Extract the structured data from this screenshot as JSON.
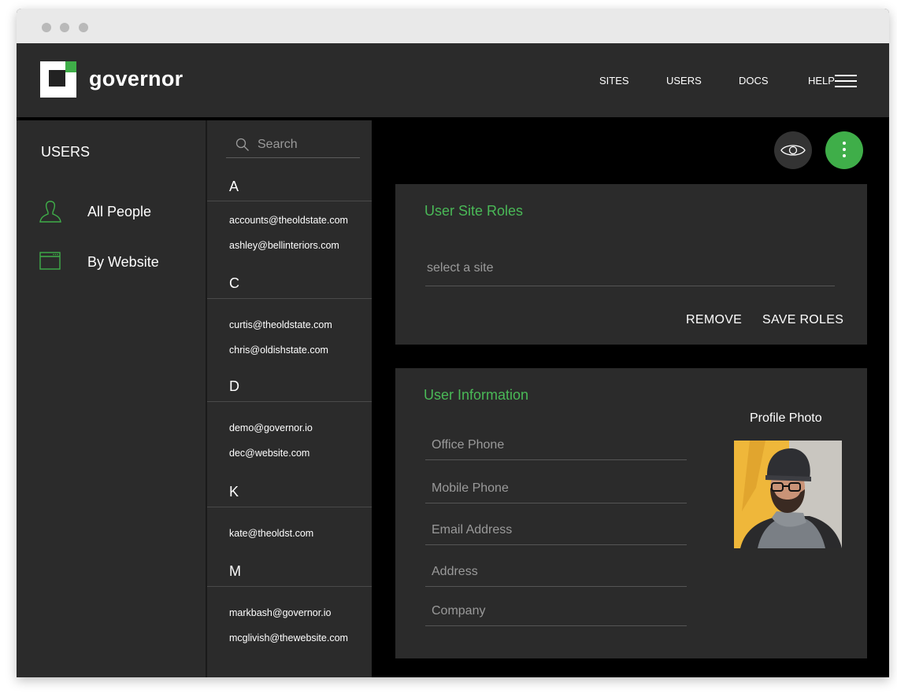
{
  "app": {
    "brand": "governor",
    "nav": [
      "SITES",
      "USERS",
      "DOCS",
      "HELP"
    ]
  },
  "sidebar": {
    "title": "USERS",
    "items": [
      {
        "label": "All People",
        "icon": "person-icon"
      },
      {
        "label": "By Website",
        "icon": "browser-window-icon"
      }
    ]
  },
  "user_list": {
    "search_placeholder": "Search",
    "groups": [
      {
        "letter": "A",
        "emails": [
          "accounts@theoldstate.com",
          "ashley@bellinteriors.com"
        ]
      },
      {
        "letter": "C",
        "emails": [
          "curtis@theoldstate.com",
          "chris@oldishstate.com"
        ]
      },
      {
        "letter": "D",
        "emails": [
          "demo@governor.io",
          "dec@website.com"
        ]
      },
      {
        "letter": "K",
        "emails": [
          "kate@theoldst.com"
        ]
      },
      {
        "letter": "M",
        "emails": [
          "markbash@governor.io",
          "mcglivish@thewebsite.com"
        ]
      }
    ]
  },
  "site_roles": {
    "title": "User Site Roles",
    "select_placeholder": "select a site",
    "remove_label": "REMOVE",
    "save_label": "SAVE ROLES"
  },
  "user_info": {
    "title": "User Information",
    "photo_label": "Profile Photo",
    "fields": [
      {
        "placeholder": "Office Phone"
      },
      {
        "placeholder": "Mobile Phone"
      },
      {
        "placeholder": "Email Address"
      },
      {
        "placeholder": "Address"
      },
      {
        "placeholder": "Company"
      }
    ]
  },
  "colors": {
    "accent": "#3fae49",
    "panel": "#2b2b2b",
    "background": "#000000"
  }
}
